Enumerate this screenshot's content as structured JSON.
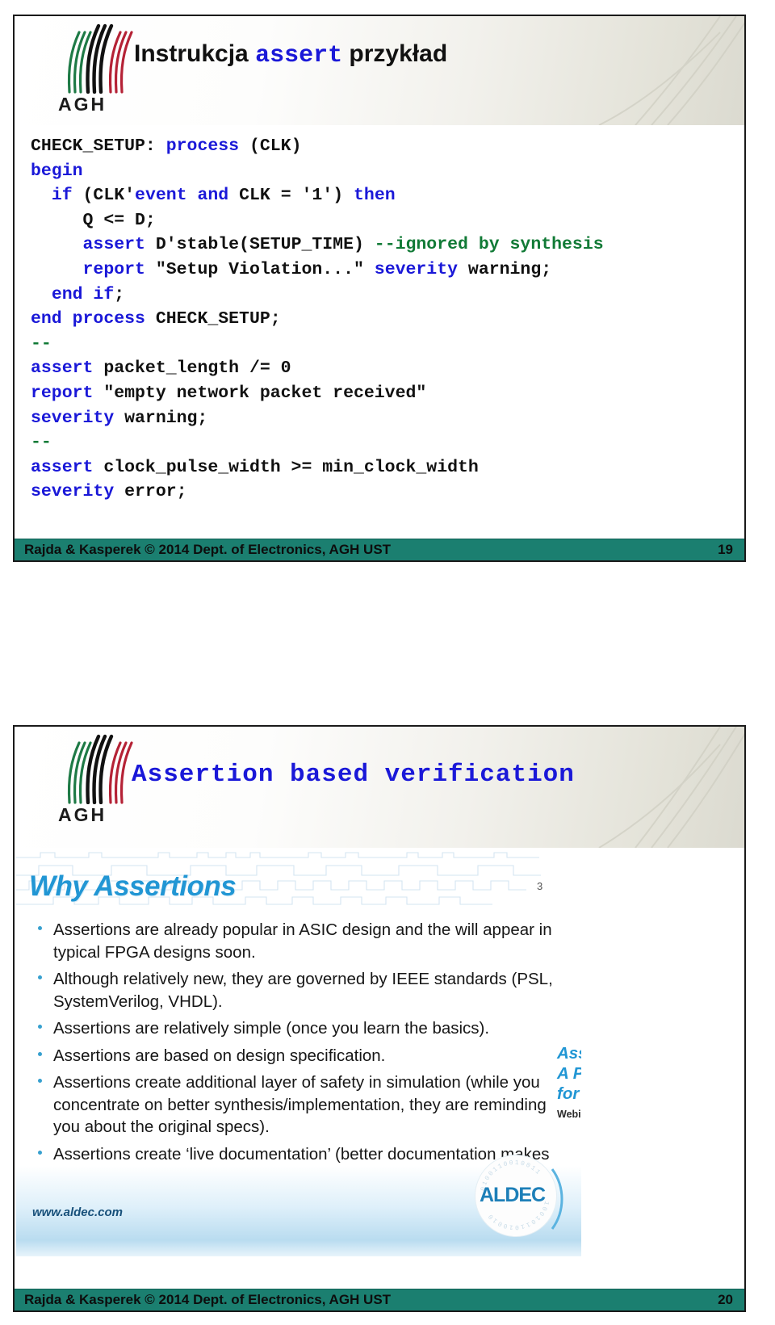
{
  "document": {
    "type": "lecture-slides-handout",
    "slide_count": 2
  },
  "slide19": {
    "logo_word": "AGH",
    "title_prefix": "Instrukcja ",
    "title_keyword": "assert",
    "title_suffix": " przykład",
    "code_lines": [
      [
        {
          "t": "CHECK_SETUP: ",
          "c": "plain"
        },
        {
          "t": "process",
          "c": "kw"
        },
        {
          "t": " (CLK)",
          "c": "plain"
        }
      ],
      [
        {
          "t": "begin",
          "c": "kw"
        }
      ],
      [
        {
          "t": "  ",
          "c": "plain"
        },
        {
          "t": "if",
          "c": "kw"
        },
        {
          "t": " (CLK'",
          "c": "plain"
        },
        {
          "t": "event",
          "c": "kw"
        },
        {
          "t": " ",
          "c": "plain"
        },
        {
          "t": "and",
          "c": "kw"
        },
        {
          "t": " CLK = '1') ",
          "c": "plain"
        },
        {
          "t": "then",
          "c": "kw"
        }
      ],
      [
        {
          "t": "     Q <= D;",
          "c": "plain"
        }
      ],
      [
        {
          "t": "     ",
          "c": "plain"
        },
        {
          "t": "assert",
          "c": "kw"
        },
        {
          "t": " D'stable(SETUP_TIME) ",
          "c": "plain"
        },
        {
          "t": "--ignored by synthesis",
          "c": "cm"
        }
      ],
      [
        {
          "t": "     ",
          "c": "plain"
        },
        {
          "t": "report",
          "c": "kw"
        },
        {
          "t": " \"Setup Violation...\" ",
          "c": "plain"
        },
        {
          "t": "severity",
          "c": "kw"
        },
        {
          "t": " warning;",
          "c": "plain"
        }
      ],
      [
        {
          "t": "  ",
          "c": "plain"
        },
        {
          "t": "end if",
          "c": "kw"
        },
        {
          "t": ";",
          "c": "plain"
        }
      ],
      [
        {
          "t": "end process",
          "c": "kw"
        },
        {
          "t": " CHECK_SETUP;",
          "c": "plain"
        }
      ],
      [
        {
          "t": "--",
          "c": "cm"
        }
      ],
      [
        {
          "t": "assert",
          "c": "kw"
        },
        {
          "t": " packet_length /= 0",
          "c": "plain"
        }
      ],
      [
        {
          "t": "report",
          "c": "kw"
        },
        {
          "t": " \"empty network packet received\"",
          "c": "plain"
        }
      ],
      [
        {
          "t": "severity",
          "c": "kw"
        },
        {
          "t": " warning;",
          "c": "plain"
        }
      ],
      [
        {
          "t": "--",
          "c": "cm"
        }
      ],
      [
        {
          "t": "assert",
          "c": "kw"
        },
        {
          "t": " clock_pulse_width >= min_clock_width",
          "c": "plain"
        }
      ],
      [
        {
          "t": "severity",
          "c": "kw"
        },
        {
          "t": " error;",
          "c": "plain"
        }
      ]
    ],
    "footer_text": "Rajda & Kasperek © 2014 Dept. of Electronics, AGH UST",
    "page_number": "19"
  },
  "slide20": {
    "logo_word": "AGH",
    "title": "Assertion based verification",
    "footer_text": "Rajda & Kasperek © 2014 Dept. of Electronics, AGH UST",
    "page_number": "20",
    "embedded": {
      "slide_number": "3",
      "title": "Why Assertions",
      "bullets": [
        "Assertions are already popular in ASIC design and the will appear in typical FPGA designs soon.",
        "Although relatively new, they are governed by IEEE standards (PSL, SystemVerilog, VHDL).",
        "Assertions are relatively simple (once you learn the basics).",
        "Assertions are based on design specification.",
        "Assertions create additional layer of safety in simulation (while you concentrate on better synthesis/implementation, they are reminding you about the original specs).",
        "Assertions create ‘live documentation’ (better documentation makes management of your design easier)."
      ],
      "webinar_title_line1": "Assertions –",
      "webinar_title_line2": "A Practical Introduction",
      "webinar_title_line3": "for HDL Designers",
      "webinar_label": "Webinar",
      "url": "www.aldec.com",
      "brand": "ALDEC"
    }
  },
  "colors": {
    "keyword_blue": "#1a18d8",
    "comment_green": "#117a36",
    "footer_teal": "#1b7f70",
    "aldec_blue": "#2196d4"
  }
}
